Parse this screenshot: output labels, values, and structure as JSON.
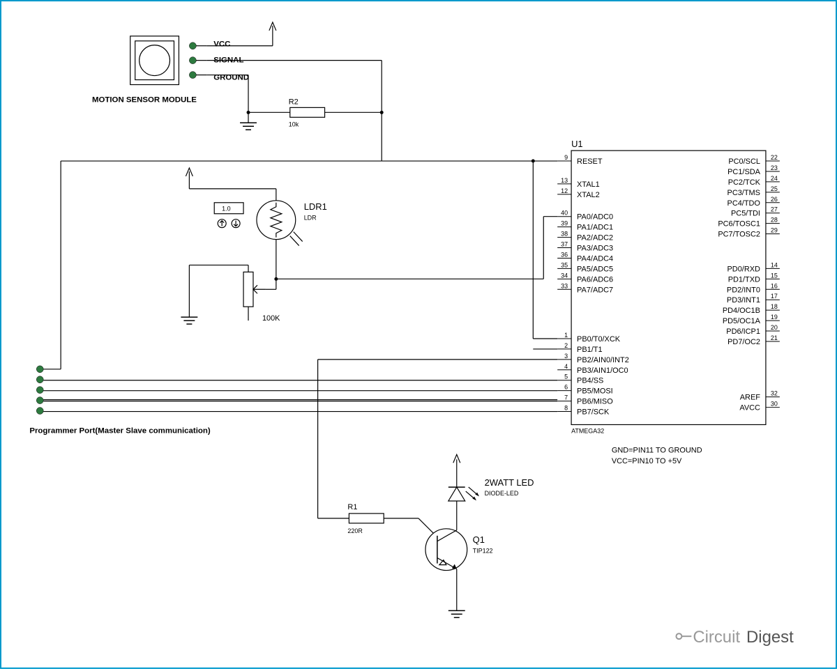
{
  "sensor": {
    "title": "MOTION SENSOR MODULE",
    "vcc": "VCC",
    "signal": "SIGNAL",
    "ground": "GROUND"
  },
  "r2": {
    "ref": "R2",
    "val": "10k"
  },
  "ldr": {
    "ref": "LDR1",
    "type": "LDR",
    "meter": "1.0"
  },
  "pot": {
    "val": "100K"
  },
  "programmer": "Programmer Port(Master Slave communication)",
  "r1": {
    "ref": "R1",
    "val": "220R"
  },
  "q1": {
    "ref": "Q1",
    "type": "TIP122"
  },
  "led": {
    "name": "2WATT LED",
    "type": "DIODE-LED"
  },
  "u1": {
    "ref": "U1",
    "part": "ATMEGA32",
    "notes": [
      "GND=PIN11  TO  GROUND",
      "VCC=PIN10  TO  +5V"
    ],
    "left": [
      {
        "num": "9",
        "name": "RESET"
      },
      {
        "num": "13",
        "name": "XTAL1"
      },
      {
        "num": "12",
        "name": "XTAL2"
      },
      {
        "num": "40",
        "name": "PA0/ADC0"
      },
      {
        "num": "39",
        "name": "PA1/ADC1"
      },
      {
        "num": "38",
        "name": "PA2/ADC2"
      },
      {
        "num": "37",
        "name": "PA3/ADC3"
      },
      {
        "num": "36",
        "name": "PA4/ADC4"
      },
      {
        "num": "35",
        "name": "PA5/ADC5"
      },
      {
        "num": "34",
        "name": "PA6/ADC6"
      },
      {
        "num": "33",
        "name": "PA7/ADC7"
      },
      {
        "num": "1",
        "name": "PB0/T0/XCK"
      },
      {
        "num": "2",
        "name": "PB1/T1"
      },
      {
        "num": "3",
        "name": "PB2/AIN0/INT2"
      },
      {
        "num": "4",
        "name": "PB3/AIN1/OC0"
      },
      {
        "num": "5",
        "name": "PB4/SS"
      },
      {
        "num": "6",
        "name": "PB5/MOSI"
      },
      {
        "num": "7",
        "name": "PB6/MISO"
      },
      {
        "num": "8",
        "name": "PB7/SCK"
      }
    ],
    "right": [
      {
        "num": "22",
        "name": "PC0/SCL"
      },
      {
        "num": "23",
        "name": "PC1/SDA"
      },
      {
        "num": "24",
        "name": "PC2/TCK"
      },
      {
        "num": "25",
        "name": "PC3/TMS"
      },
      {
        "num": "26",
        "name": "PC4/TDO"
      },
      {
        "num": "27",
        "name": "PC5/TDI"
      },
      {
        "num": "28",
        "name": "PC6/TOSC1"
      },
      {
        "num": "29",
        "name": "PC7/TOSC2"
      },
      {
        "num": "14",
        "name": "PD0/RXD"
      },
      {
        "num": "15",
        "name": "PD1/TXD"
      },
      {
        "num": "16",
        "name": "PD2/INT0"
      },
      {
        "num": "17",
        "name": "PD3/INT1"
      },
      {
        "num": "18",
        "name": "PD4/OC1B"
      },
      {
        "num": "19",
        "name": "PD5/OC1A"
      },
      {
        "num": "20",
        "name": "PD6/ICP1"
      },
      {
        "num": "21",
        "name": "PD7/OC2"
      },
      {
        "num": "32",
        "name": "AREF"
      },
      {
        "num": "30",
        "name": "AVCC"
      }
    ]
  },
  "logo": {
    "a": "Circuit",
    "b": "Digest"
  }
}
